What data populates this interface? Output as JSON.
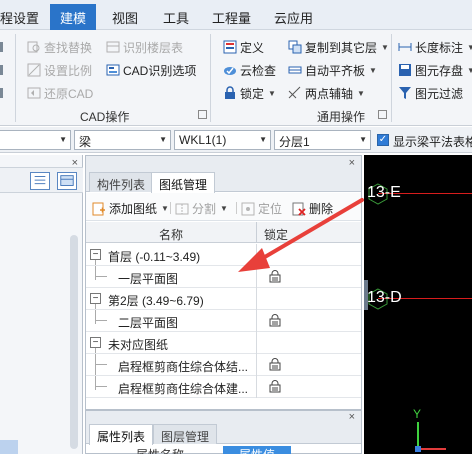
{
  "menubar": {
    "items": [
      "程设置",
      "建模",
      "视图",
      "工具",
      "工程量",
      "云应用"
    ],
    "active": "建模"
  },
  "ribbon": {
    "cad_group": {
      "buttons": [
        {
          "label": "查找替换",
          "enabled": false
        },
        {
          "label": "识别楼层表",
          "enabled": false
        },
        {
          "label": "设置比例",
          "enabled": false
        },
        {
          "label": "CAD识别选项",
          "enabled": true
        },
        {
          "label": "还原CAD",
          "enabled": false
        }
      ],
      "label": "CAD操作"
    },
    "common_group": {
      "buttons": [
        {
          "label": "定义"
        },
        {
          "label": "复制到其它层"
        },
        {
          "label": "长度标注"
        },
        {
          "label": "云检查"
        },
        {
          "label": "自动平齐板"
        },
        {
          "label": "图元存盘"
        },
        {
          "label": "锁定"
        },
        {
          "label": "两点辅轴"
        },
        {
          "label": "图元过滤"
        }
      ],
      "label": "通用操作"
    }
  },
  "selectors": {
    "type": "梁",
    "component": "WKL1(1)",
    "layer": "分层1",
    "show_flat_checkbox": "显示梁平法表格"
  },
  "drawings_panel": {
    "tabs": [
      "构件列表",
      "图纸管理"
    ],
    "active_tab": "图纸管理",
    "toolbar": [
      {
        "label": "添加图纸",
        "enabled": true
      },
      {
        "label": "分割",
        "enabled": false
      },
      {
        "label": "定位",
        "enabled": false
      },
      {
        "label": "删除",
        "enabled": true
      }
    ],
    "columns": [
      "名称",
      "锁定"
    ],
    "rows": [
      {
        "label": "首层 (-0.11~3.49)",
        "level": 0
      },
      {
        "label": "一层平面图",
        "level": 1,
        "locked": true
      },
      {
        "label": "第2层 (3.49~6.79)",
        "level": 0
      },
      {
        "label": "二层平面图",
        "level": 1,
        "locked": true
      },
      {
        "label": "未对应图纸",
        "level": 0
      },
      {
        "label": "启程框剪商住综合体结...",
        "level": 1,
        "locked": true
      },
      {
        "label": "启程框剪商住综合体建...",
        "level": 1,
        "locked": true
      }
    ]
  },
  "properties_panel": {
    "tabs": [
      "属性列表",
      "图层管理"
    ],
    "active_tab": "属性列表",
    "columns": [
      "属性名称",
      "属性值"
    ]
  },
  "canvas": {
    "axis_labels": [
      "13-E",
      "13-D"
    ],
    "ucs_label": "Y",
    "axis_color": "#d71d1d"
  },
  "colors": {
    "accent": "#2a74c9",
    "arrow": "#e8403a"
  }
}
